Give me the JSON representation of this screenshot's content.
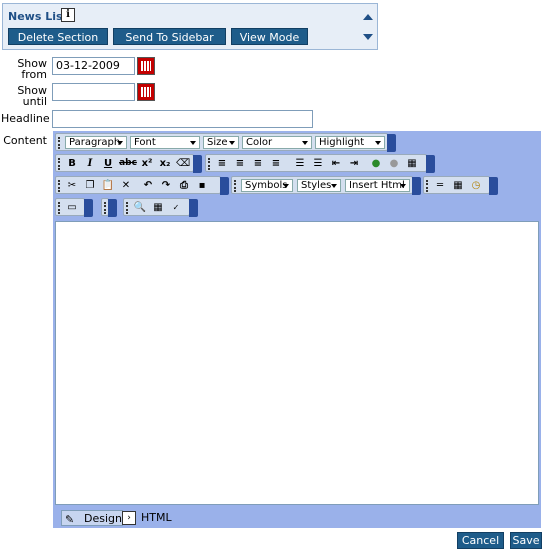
{
  "panel": {
    "title": "News List",
    "info_icon": "i",
    "buttons": [
      "Delete Section",
      "Send To Sidebar",
      "View Mode"
    ]
  },
  "form": {
    "show_from_label": "Show from",
    "show_from_value": "03-12-2009",
    "show_until_label": "Show until",
    "show_until_value": "",
    "headline_label": "Headline",
    "headline_value": "",
    "content_label": "Content"
  },
  "editor": {
    "dropdowns_row1": [
      "Paragraph",
      "Font",
      "Size",
      "Color",
      "Highlight"
    ],
    "dropdowns_row3": [
      "Symbols",
      "Styles",
      "Insert Html"
    ],
    "format_buttons": [
      "B",
      "I",
      "U",
      "abc",
      "x²",
      "x₂"
    ],
    "modes": [
      "Design",
      "HTML"
    ]
  },
  "actions": {
    "cancel": "Cancel",
    "save": "Save"
  }
}
